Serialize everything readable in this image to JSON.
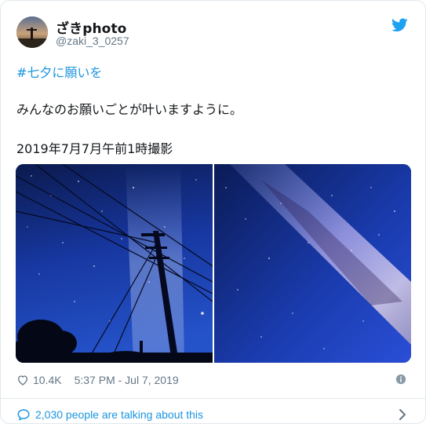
{
  "author": {
    "name": "ざきphoto",
    "handle": "@zaki_3_0257"
  },
  "tweet": {
    "hashtag": "#七夕に願いを",
    "line1": "みんなのお願いごとが叶いますように。",
    "line2": "2019年7月7月午前1時撮影"
  },
  "meta": {
    "likes": "10.4K",
    "timestamp": "5:37 PM - Jul 7, 2019"
  },
  "footer": {
    "talking": "2,030 people are talking about this"
  },
  "colors": {
    "link": "#1b95e0",
    "text": "#14171a",
    "muted": "#657786",
    "border": "#e1e8ed"
  },
  "icons": [
    "twitter-bird-icon",
    "heart-icon",
    "info-icon",
    "speech-bubble-icon",
    "chevron-right-icon"
  ]
}
